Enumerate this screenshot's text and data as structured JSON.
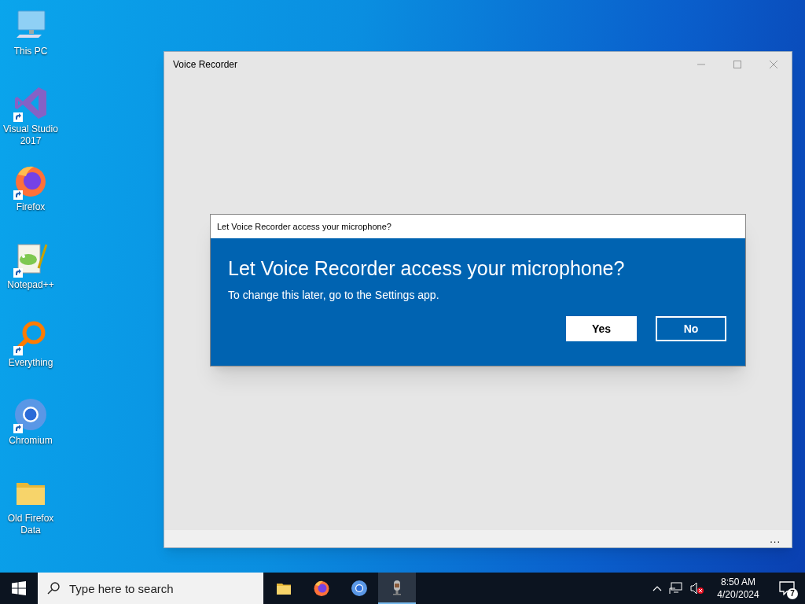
{
  "desktop_icons": [
    {
      "label": "This PC",
      "kind": "computer",
      "shortcut": false
    },
    {
      "label": "Visual Studio 2017",
      "kind": "ide",
      "shortcut": true
    },
    {
      "label": "Firefox",
      "kind": "firefox",
      "shortcut": true
    },
    {
      "label": "Notepad++",
      "kind": "notepad",
      "shortcut": true
    },
    {
      "label": "Everything",
      "kind": "magnifier",
      "shortcut": true
    },
    {
      "label": "Chromium",
      "kind": "chromium",
      "shortcut": true
    },
    {
      "label": "Old Firefox Data",
      "kind": "folder",
      "shortcut": false
    }
  ],
  "window": {
    "title": "Voice Recorder",
    "more": "..."
  },
  "dialog": {
    "title": "Let Voice Recorder access your microphone?",
    "heading": "Let Voice Recorder access your microphone?",
    "message": "To change this later, go to the Settings app.",
    "buttons": [
      {
        "label": "Yes",
        "kind": "primary"
      },
      {
        "label": "No",
        "kind": "secondary"
      }
    ]
  },
  "taskbar": {
    "search_placeholder": "Type here to search",
    "apps": [
      {
        "kind": "folder",
        "selected": false
      },
      {
        "kind": "firefox",
        "selected": false
      },
      {
        "kind": "chromium",
        "selected": false
      },
      {
        "kind": "microphone",
        "selected": true
      }
    ],
    "time": "8:50 AM",
    "date": "4/20/2024",
    "notification_count": "7"
  }
}
